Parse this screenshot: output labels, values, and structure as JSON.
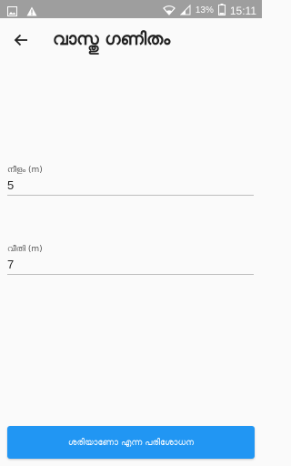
{
  "status_bar": {
    "battery_percent": "13%",
    "clock": "15:11"
  },
  "header": {
    "title": "വാസ്തു ഗണിതം"
  },
  "form": {
    "fields": [
      {
        "label": "നീളം (m)",
        "value": "5"
      },
      {
        "label": "വീതി (m)",
        "value": "7"
      }
    ],
    "submit_label": "ശരിയാണോ എന്ന പരിശോധന"
  },
  "colors": {
    "status_bar": "#9e9e9e",
    "accent": "#2196f3",
    "background": "#fafafa"
  }
}
